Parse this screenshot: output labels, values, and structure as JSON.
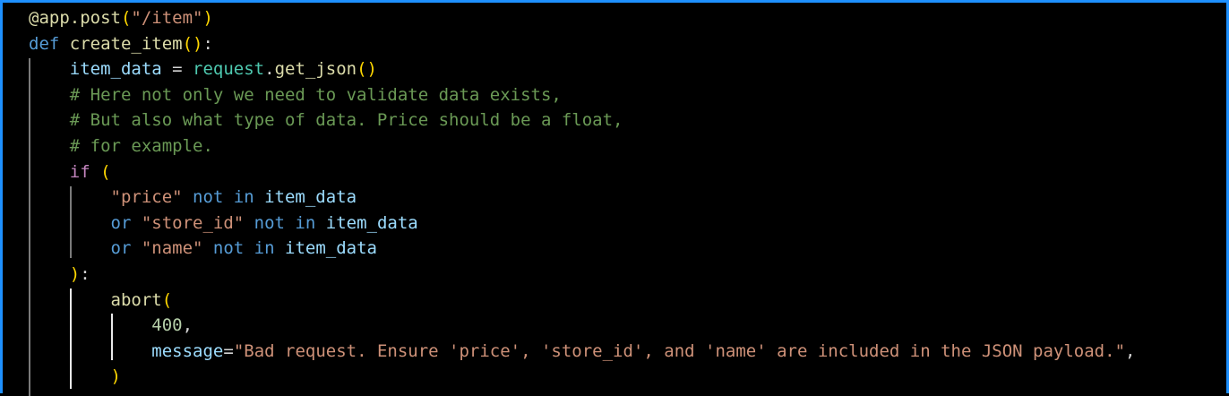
{
  "editor": {
    "language": "python",
    "lines": [
      [
        {
          "t": "@app.post",
          "c": "dec"
        },
        {
          "t": "(",
          "c": "p1"
        },
        {
          "t": "\"/item\"",
          "c": "str"
        },
        {
          "t": ")",
          "c": "p1"
        }
      ],
      [
        {
          "t": "def ",
          "c": "kw"
        },
        {
          "t": "create_item",
          "c": "fn"
        },
        {
          "t": "()",
          "c": "p1"
        },
        {
          "t": ":",
          "c": "punc"
        }
      ],
      [
        {
          "t": "    ",
          "c": "punc"
        },
        {
          "t": "item_data",
          "c": "var"
        },
        {
          "t": " = ",
          "c": "punc"
        },
        {
          "t": "request",
          "c": "cls"
        },
        {
          "t": ".",
          "c": "punc"
        },
        {
          "t": "get_json",
          "c": "fn"
        },
        {
          "t": "()",
          "c": "p1"
        }
      ],
      [
        {
          "t": "    ",
          "c": "punc"
        },
        {
          "t": "# Here not only we need to validate data exists,",
          "c": "cmt"
        }
      ],
      [
        {
          "t": "    ",
          "c": "punc"
        },
        {
          "t": "# But also what type of data. Price should be a float,",
          "c": "cmt"
        }
      ],
      [
        {
          "t": "    ",
          "c": "punc"
        },
        {
          "t": "# for example.",
          "c": "cmt"
        }
      ],
      [
        {
          "t": "    ",
          "c": "punc"
        },
        {
          "t": "if ",
          "c": "ctl"
        },
        {
          "t": "(",
          "c": "p1"
        }
      ],
      [
        {
          "t": "        ",
          "c": "punc"
        },
        {
          "t": "\"price\"",
          "c": "str"
        },
        {
          "t": " not in ",
          "c": "kw"
        },
        {
          "t": "item_data",
          "c": "var"
        }
      ],
      [
        {
          "t": "        ",
          "c": "punc"
        },
        {
          "t": "or ",
          "c": "kw"
        },
        {
          "t": "\"store_id\"",
          "c": "str"
        },
        {
          "t": " not in ",
          "c": "kw"
        },
        {
          "t": "item_data",
          "c": "var"
        }
      ],
      [
        {
          "t": "        ",
          "c": "punc"
        },
        {
          "t": "or ",
          "c": "kw"
        },
        {
          "t": "\"name\"",
          "c": "str"
        },
        {
          "t": " not in ",
          "c": "kw"
        },
        {
          "t": "item_data",
          "c": "var"
        }
      ],
      [
        {
          "t": "    ",
          "c": "punc"
        },
        {
          "t": ")",
          "c": "p1"
        },
        {
          "t": ":",
          "c": "punc"
        }
      ],
      [
        {
          "t": "        ",
          "c": "punc"
        },
        {
          "t": "abort",
          "c": "fn"
        },
        {
          "t": "(",
          "c": "p1"
        }
      ],
      [
        {
          "t": "            ",
          "c": "punc"
        },
        {
          "t": "400",
          "c": "num"
        },
        {
          "t": ",",
          "c": "punc"
        }
      ],
      [
        {
          "t": "            ",
          "c": "punc"
        },
        {
          "t": "message",
          "c": "var"
        },
        {
          "t": "=",
          "c": "punc"
        },
        {
          "t": "\"Bad request. Ensure 'price', 'store_id', and 'name' are included in the JSON payload.\"",
          "c": "str"
        },
        {
          "t": ",",
          "c": "punc"
        }
      ],
      [
        {
          "t": "        ",
          "c": "punc"
        },
        {
          "t": ")",
          "c": "p1"
        }
      ]
    ]
  },
  "colors": {
    "background": "#000000",
    "border": "#1e90ff",
    "keyword": "#569cd6",
    "control": "#c586c0",
    "function": "#dcdcaa",
    "variable": "#9cdcfe",
    "class": "#4ec9b0",
    "string": "#ce9178",
    "number": "#b5cea8",
    "comment": "#6a9955",
    "bracket": "#ffd700"
  }
}
